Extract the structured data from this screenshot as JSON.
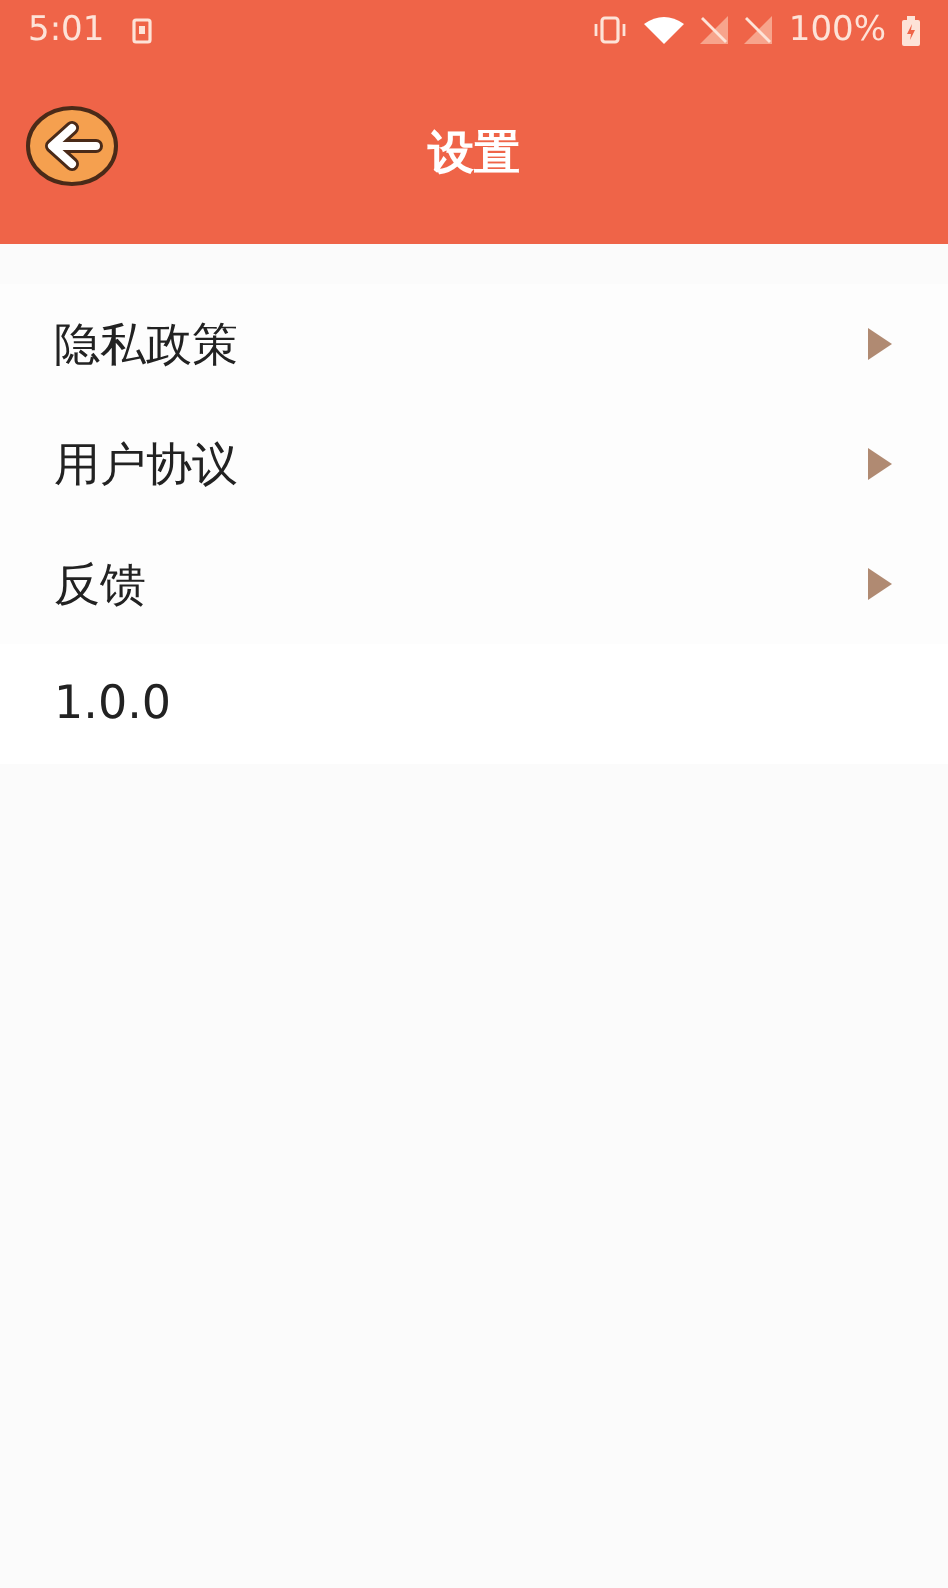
{
  "status_bar": {
    "time": "5:01",
    "battery": "100%"
  },
  "header": {
    "title": "设置"
  },
  "items": [
    {
      "kind": "link",
      "label": "隐私政策"
    },
    {
      "kind": "link",
      "label": "用户协议"
    },
    {
      "kind": "link",
      "label": "反馈"
    },
    {
      "kind": "version",
      "label": "1.0.0"
    }
  ]
}
